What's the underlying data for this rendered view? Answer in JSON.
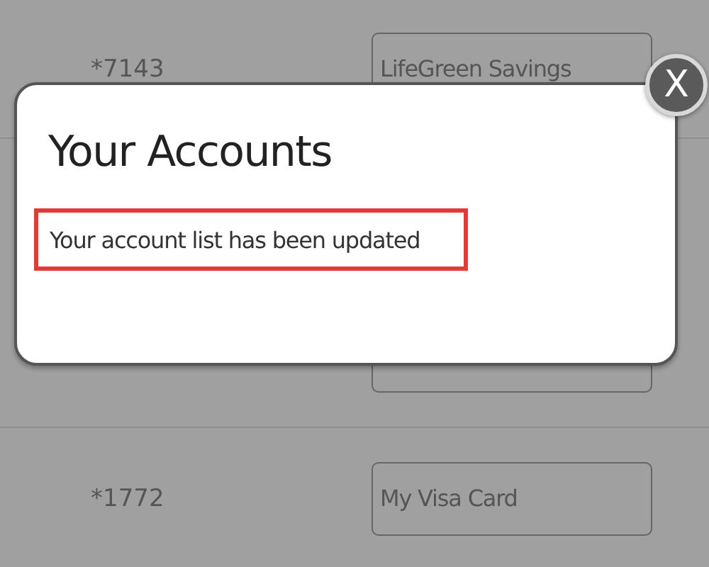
{
  "accounts": [
    {
      "kind": "account",
      "number": "*7143",
      "nickname": "LifeGreen Savings"
    },
    {
      "kind": "covered"
    },
    {
      "kind": "account",
      "number": "*1772",
      "nickname": "My Visa Card"
    }
  ],
  "dialog": {
    "title": "Your Accounts",
    "message": "Your account list has been updated",
    "close": "X"
  }
}
